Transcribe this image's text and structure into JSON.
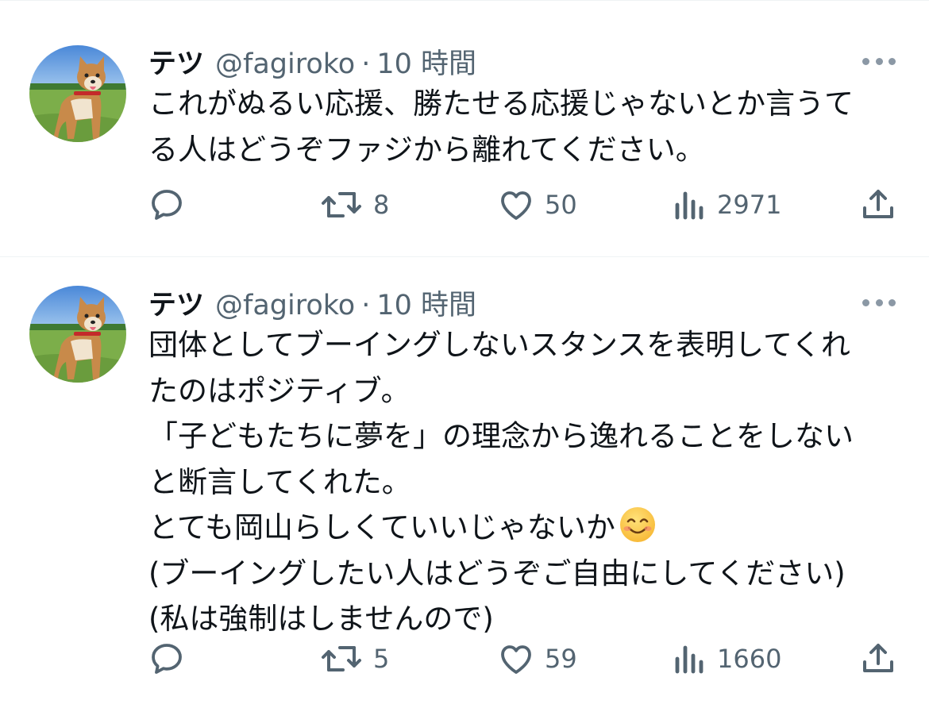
{
  "tweets": [
    {
      "display_name": "テツ",
      "handle": "@fagiroko",
      "separator": "·",
      "time": "10 時間",
      "lines": [
        "これがぬるい応援、勝たせる応援じゃないとか言うて",
        "る人はどうぞファジから離れてください。"
      ],
      "replies": "",
      "retweets": "8",
      "likes": "50",
      "views": "2971"
    },
    {
      "display_name": "テツ",
      "handle": "@fagiroko",
      "separator": "·",
      "time": "10 時間",
      "lines": [
        "団体としてブーイングしないスタンスを表明してくれ",
        "たのはポジティブ。",
        "「子どもたちに夢を」の理念から逸れることをしない",
        "と断言してくれた。",
        "とても岡山らしくていいじゃないか",
        "(ブーイングしたい人はどうぞご自由にしてください)",
        "(私は強制はしませんので)"
      ],
      "emoji_after_line": 4,
      "emoji_icon": "smiling-face-emoji",
      "replies": "",
      "retweets": "5",
      "likes": "59",
      "views": "1660"
    }
  ],
  "icons": {
    "reply": "reply-icon",
    "retweet": "retweet-icon",
    "like": "heart-icon",
    "views": "views-icon",
    "share": "share-icon",
    "more": "more-icon"
  },
  "colors": {
    "text": "#0f1419",
    "secondary": "#536471",
    "divider": "#eff3f4"
  }
}
